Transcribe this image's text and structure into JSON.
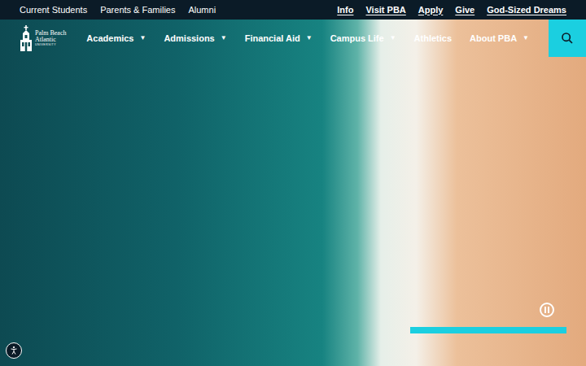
{
  "utility_bar": {
    "left_links": [
      "Current Students",
      "Parents & Families",
      "Alumni"
    ],
    "right_links": [
      "Info",
      "Visit PBA",
      "Apply",
      "Give",
      "God-Sized Dreams"
    ]
  },
  "logo": {
    "name": "Palm Beach Atlantic",
    "subtitle": "UNIVERSITY"
  },
  "menu_arrow": "▼",
  "nav": [
    {
      "label": "Academics",
      "has_menu": true
    },
    {
      "label": "Admissions",
      "has_menu": true
    },
    {
      "label": "Financial Aid",
      "has_menu": true
    },
    {
      "label": "Campus Life",
      "has_menu": true
    },
    {
      "label": "Athletics",
      "has_menu": false
    },
    {
      "label": "About PBA",
      "has_menu": true
    }
  ],
  "hero": {
    "playing": true,
    "progress": {
      "level": 1
    }
  }
}
